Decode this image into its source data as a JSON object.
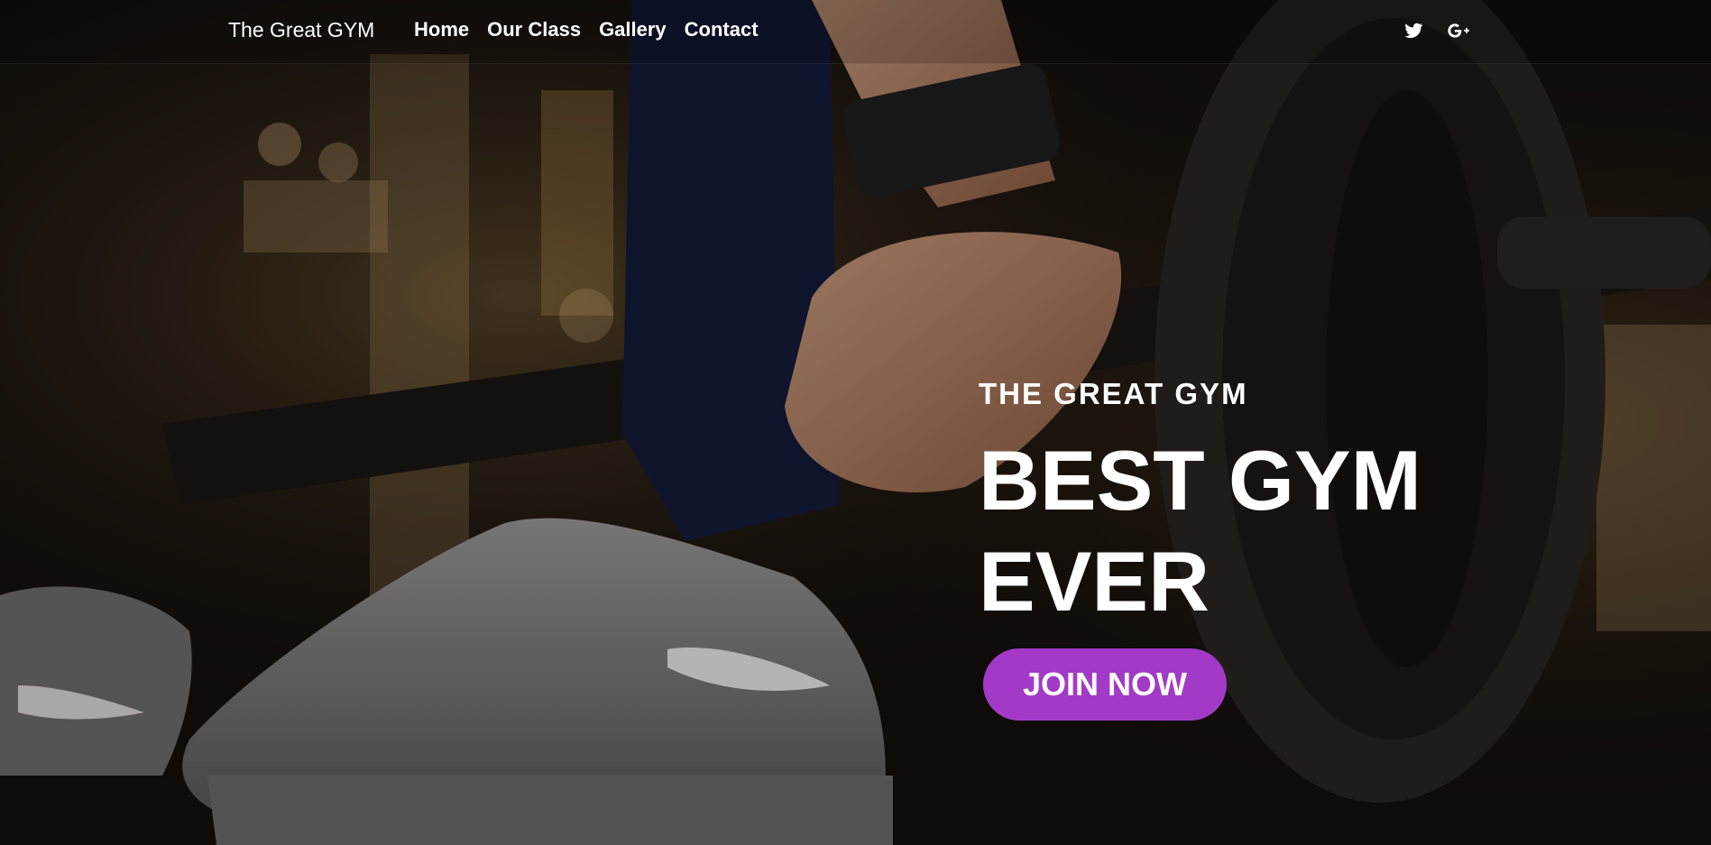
{
  "nav": {
    "brand": "The Great GYM",
    "links": [
      "Home",
      "Our Class",
      "Gallery",
      "Contact"
    ],
    "social": [
      "twitter-icon",
      "google-plus-icon"
    ]
  },
  "hero": {
    "eyebrow": "THE GREAT GYM",
    "headline": "BEST GYM EVER",
    "cta_label": "JOIN NOW"
  },
  "colors": {
    "cta": "#a23ac7",
    "text": "#ffffff"
  }
}
